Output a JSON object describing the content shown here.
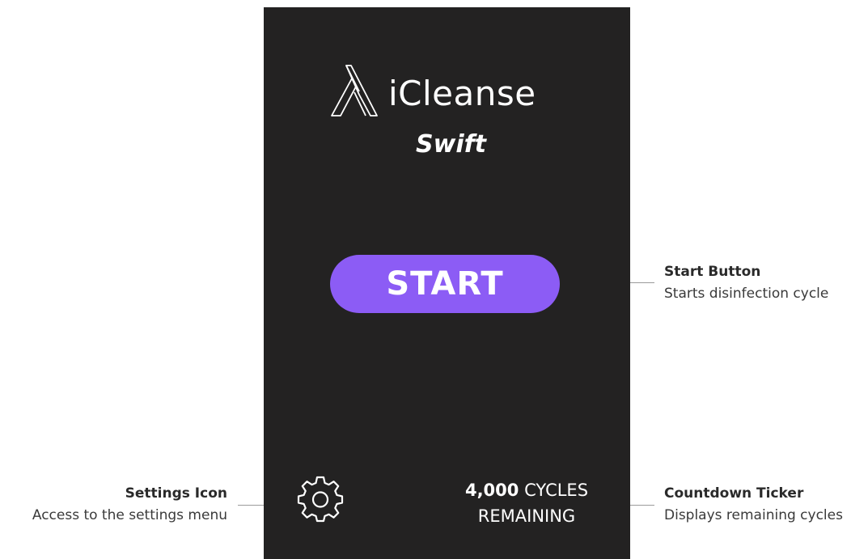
{
  "device": {
    "brand_name": "iCleanse",
    "brand_sub": "Swift",
    "start_label": "START",
    "cycles_count": "4,000",
    "cycles_unit": "CYCLES",
    "cycles_remaining": "REMAINING",
    "colors": {
      "screen_bg": "#232222",
      "start_button": "#8c5cf5",
      "text": "#ffffff"
    }
  },
  "callouts": {
    "start": {
      "title": "Start Button",
      "description": "Starts disinfection cycle"
    },
    "settings": {
      "title": "Settings Icon",
      "description": "Access to the settings menu"
    },
    "countdown": {
      "title": "Countdown Ticker",
      "description": "Displays remaining cycles"
    }
  },
  "icons": {
    "logo": "icleanse-logo-icon",
    "settings": "gear-icon"
  }
}
